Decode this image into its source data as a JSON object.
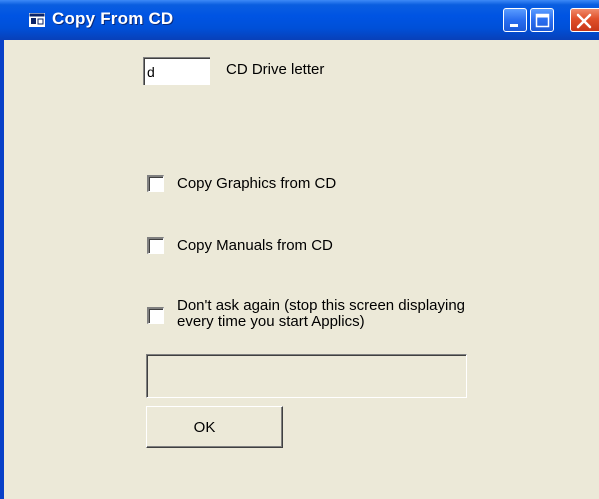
{
  "window": {
    "title": "Copy From CD",
    "title_icon": "window-app-icon",
    "controls": [
      "minimize-icon",
      "maximize-icon",
      "close-icon"
    ],
    "colors": {
      "titlebar": "#0054e3",
      "client": "#ece9d8",
      "close_button": "#e0502a"
    }
  },
  "form": {
    "drive_letter": {
      "value": "d",
      "label": "CD Drive letter"
    },
    "copy_graphics": {
      "label": "Copy Graphics from CD",
      "checked": false
    },
    "copy_manuals": {
      "label": "Copy Manuals from CD",
      "checked": false
    },
    "dont_ask_again": {
      "label_line1": "Don't ask again (stop this screen displaying",
      "label_line2": "every time you start Applics)",
      "checked": false
    },
    "progress_percent": 0,
    "ok_label": "OK"
  }
}
